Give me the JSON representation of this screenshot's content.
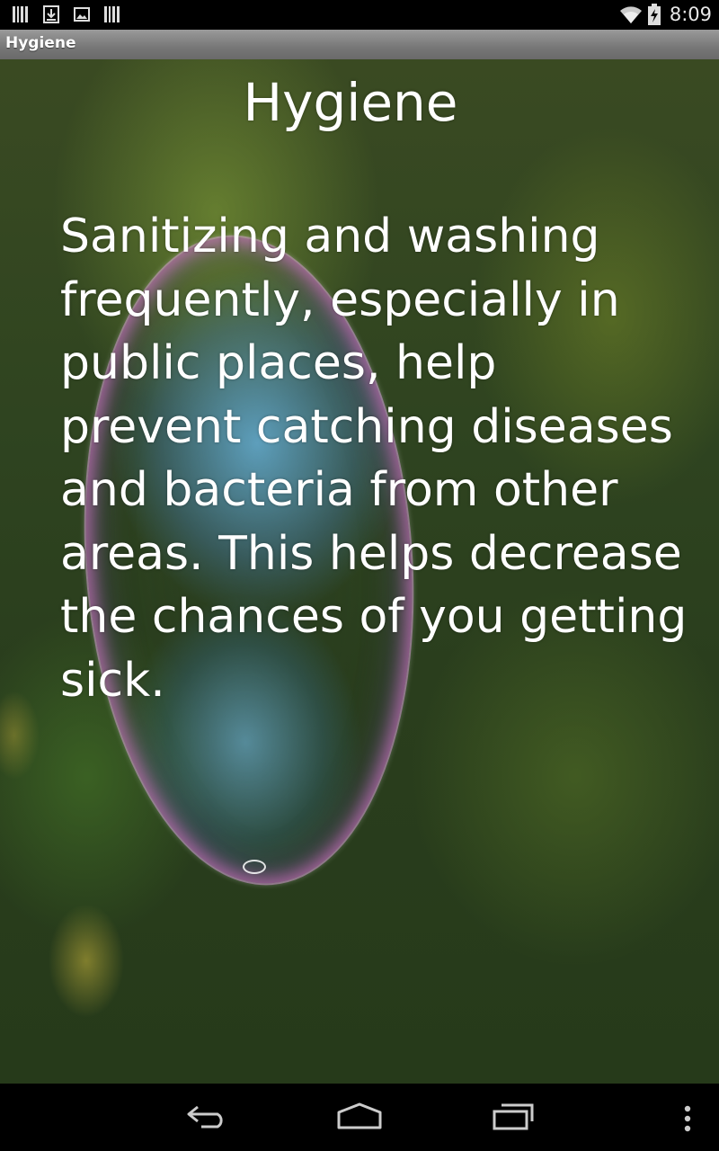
{
  "status_bar": {
    "left_icons": [
      "barcode-icon",
      "download-icon",
      "image-icon",
      "barcode-icon"
    ],
    "right_icons": [
      "wifi-icon",
      "battery-charging-icon"
    ],
    "time": "8:09"
  },
  "app_bar": {
    "title": "Hygiene"
  },
  "main": {
    "heading": "Hygiene",
    "body": "Sanitizing and washing frequently, especially in public places, help prevent catching diseases and bacteria from other areas. This helps decrease the chances of you getting sick.",
    "background": "soap-bubble-photo"
  },
  "nav_bar": {
    "buttons": [
      "back-icon",
      "home-icon",
      "recent-apps-icon",
      "overflow-menu-icon"
    ]
  }
}
